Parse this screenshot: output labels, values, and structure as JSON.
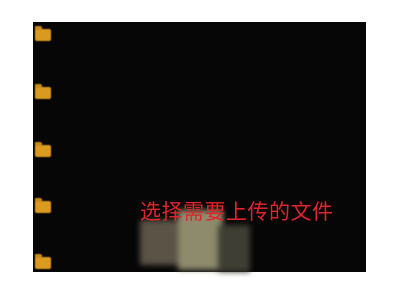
{
  "colors": {
    "screen_background": "#060606",
    "folder": "#d99a1e",
    "caption": "#e0242c"
  },
  "files": [
    {
      "icon": "folder-icon",
      "name": "",
      "meta": ""
    },
    {
      "icon": "folder-icon",
      "name": "",
      "meta": ""
    },
    {
      "icon": "folder-icon",
      "name": "",
      "meta": ""
    },
    {
      "icon": "folder-icon",
      "name": "",
      "meta": ""
    },
    {
      "icon": "folder-icon",
      "name": "",
      "meta": ""
    }
  ],
  "thumbnail": {
    "icon": "image-thumbnail-icon"
  },
  "caption": "选择需要上传的文件"
}
